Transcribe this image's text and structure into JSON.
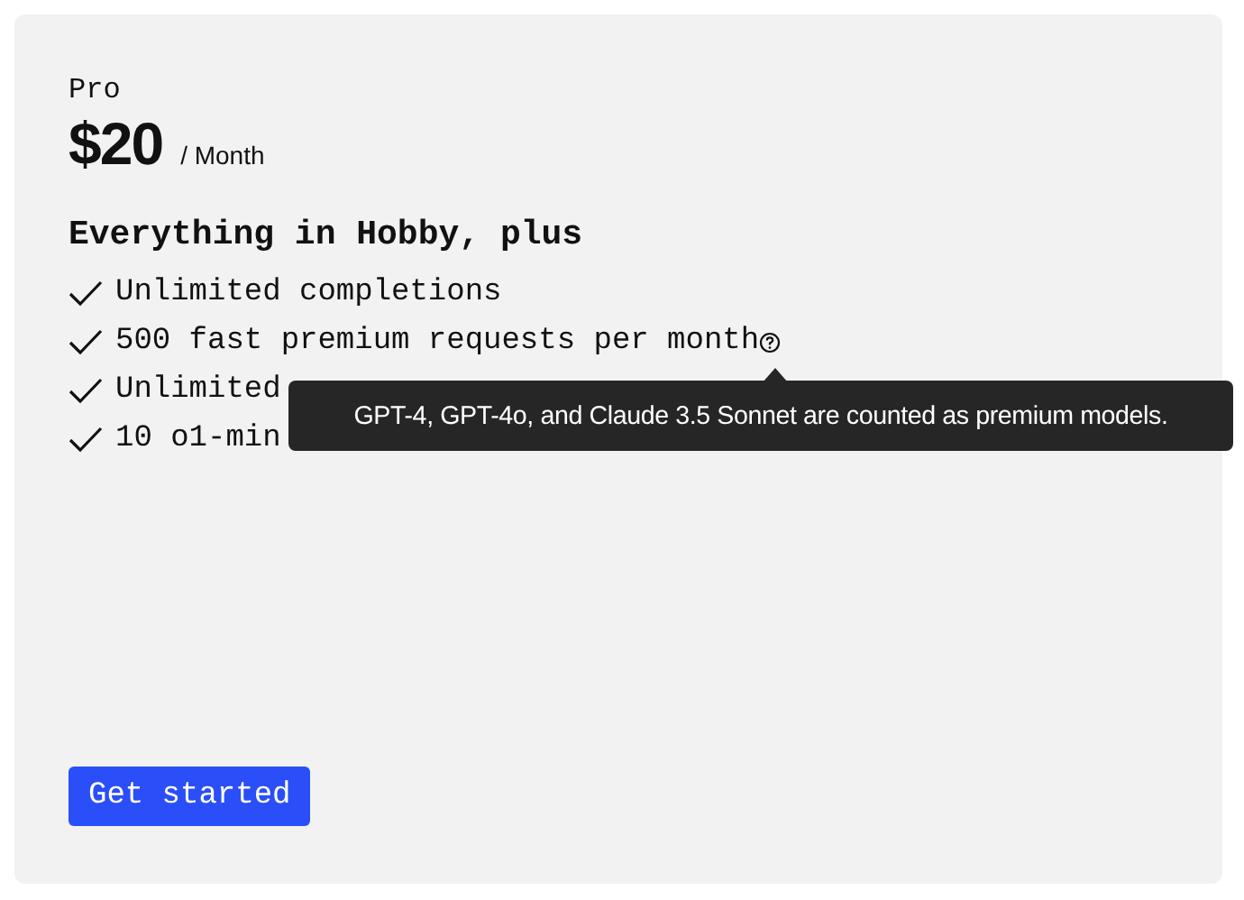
{
  "plan": {
    "name": "Pro",
    "price": "$20",
    "period": "/ Month"
  },
  "features_heading": "Everything in Hobby, plus",
  "features": [
    {
      "text": "Unlimited completions"
    },
    {
      "text": "500 fast premium requests per month",
      "help_tooltip": "GPT-4, GPT-4o, and Claude 3.5 Sonnet are counted as premium models."
    },
    {
      "text": "Unlimited"
    },
    {
      "text": "10 o1-min"
    }
  ],
  "button": {
    "label": "Get started"
  }
}
